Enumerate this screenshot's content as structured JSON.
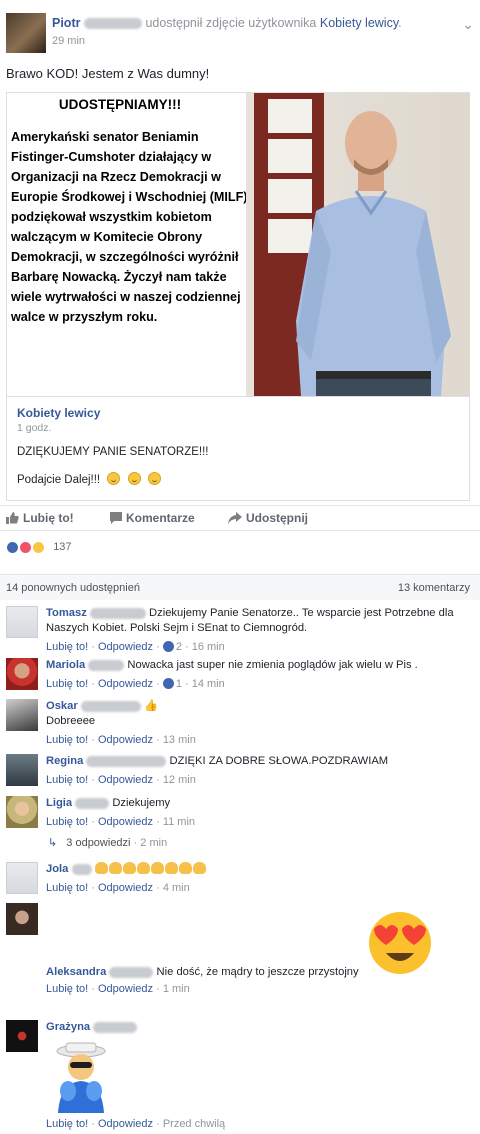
{
  "post": {
    "author": "Piotr",
    "action_text": "udostępnił zdjęcie użytkownika",
    "shared_from": "Kobiety lewicy",
    "time": "29 min",
    "status": "Brawo KOD! Jestem z Was dumny!"
  },
  "meme": {
    "title": "UDOSTĘPNIAMY!!!",
    "body": "Amerykański senator Beniamin Fistinger-Cumshoter działający w Organizacji na Rzecz Demokracji w Europie Środkowej i Wschodniej (MILF) podziękował wszystkim kobietom walczącym w Komitecie Obrony Demokracji, w szczególności wyróżnił Barbarę Nowacką. Życzył nam także wiele wytrwałości w naszej codziennej walce w przyszłym roku."
  },
  "source": {
    "name": "Kobiety lewicy",
    "time": "1 godz.",
    "text1": "DZIĘKUJEMY PANIE SENATORZE!!!",
    "text2": "Podajcie Dalej!!!"
  },
  "actions": {
    "like": "Lubię to!",
    "comment": "Komentarze",
    "share": "Udostępnij"
  },
  "reactions": {
    "count": "137"
  },
  "counts": {
    "shares": "14 ponownych udostępnień",
    "comments": "13 komentarzy"
  },
  "comment_actions": {
    "like": "Lubię to!",
    "reply": "Odpowiedz"
  },
  "comments": [
    {
      "name": "Tomasz",
      "text": "Dziekujemy Panie Senatorze.. Te wsparcie jest Potrzebne dla Naszych Kobiet. Polski Sejm i SEnat to Ciemnogród.",
      "likes": "2",
      "time": "16 min"
    },
    {
      "name": "Mariola",
      "text": "Nowacka jast super nie zmienia poglądów jak wielu w Pis .",
      "likes": "1",
      "time": "14 min"
    },
    {
      "name": "Oskar",
      "text": "Dobreeee",
      "time": "13 min"
    },
    {
      "name": "Regina",
      "text": "DZIĘKI ZA DOBRE SŁOWA.POZDRAWIAM",
      "time": "12 min"
    },
    {
      "name": "Ligia",
      "text": "Dziekujemy",
      "time": "11 min",
      "replies": "3 odpowiedzi",
      "replies_time": "2 min"
    },
    {
      "name": "Jola",
      "text": "",
      "time": "4 min"
    },
    {
      "name": "Aleksandra",
      "text": "Nie dość, że mądry to jeszcze przystojny",
      "time": "1 min"
    },
    {
      "name": "Grażyna",
      "text": "",
      "time": "Przed chwilą"
    }
  ],
  "colors": {
    "link": "#365899",
    "like_blue": "#4267b2",
    "muted": "#90949c"
  }
}
